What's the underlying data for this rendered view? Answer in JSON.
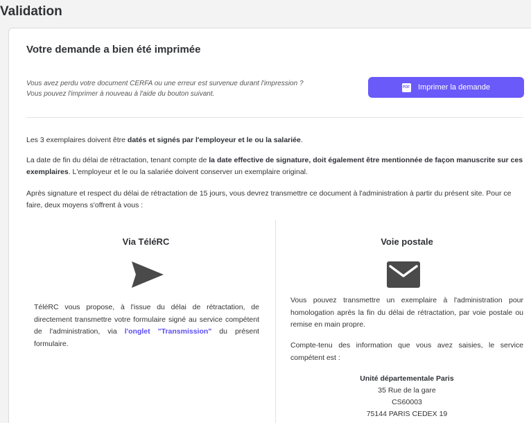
{
  "page": {
    "title": "Validation"
  },
  "card": {
    "title": "Votre demande a bien été imprimée",
    "notice_line1": "Vous avez perdu votre document CERFA ou une erreur est survenue durant l'impression ?",
    "notice_line2": "Vous pouvez l'imprimer à nouveau à l'aide du bouton suivant.",
    "print_button": {
      "label": "Imprimer la demande",
      "icon": "pdf-icon"
    }
  },
  "paragraphs": {
    "p1_pre": "Les 3 exemplaires doivent être ",
    "p1_bold": "datés et signés par l'employeur et le ou la salariée",
    "p1_post": ".",
    "p2_pre": "La date de fin du délai de rétractation, tenant compte de ",
    "p2_bold": "la date effective de signature, doit également être mentionnée de façon manuscrite sur ces exemplaires",
    "p2_post": ". L'employeur et le ou la salariée doivent conserver un exemplaire original.",
    "p3": "Après signature et respect du délai de rétractation de 15 jours, vous devrez transmettre ce document à l'administration à partir du présent site. Pour ce faire, deux moyens s'offrent à vous :"
  },
  "left_column": {
    "title": "Via TéléRC",
    "icon": "send-icon",
    "text_pre": "TéléRC vous propose, à l'issue du délai de rétractation, de directement transmettre votre formulaire signé au service compétent de l'administration, via ",
    "link": "l'onglet \"Transmission\"",
    "text_post": " du présent formulaire."
  },
  "right_column": {
    "title": "Voie postale",
    "icon": "mail-icon",
    "text1": "Vous pouvez transmettre un exemplaire à l'administration pour homologation après la fin du délai de rétractation, par voie postale ou remise en main propre.",
    "text2": "Compte-tenu des information que vous avez saisies, le service compétent est :",
    "address": {
      "name": "Unité départementale Paris",
      "line1": "35 Rue de la gare",
      "line2": "CS60003",
      "line3": "75144 PARIS CEDEX 19"
    }
  },
  "colors": {
    "accent": "#6a5af9",
    "link": "#5b4df2",
    "icon": "#4a4a4a"
  }
}
